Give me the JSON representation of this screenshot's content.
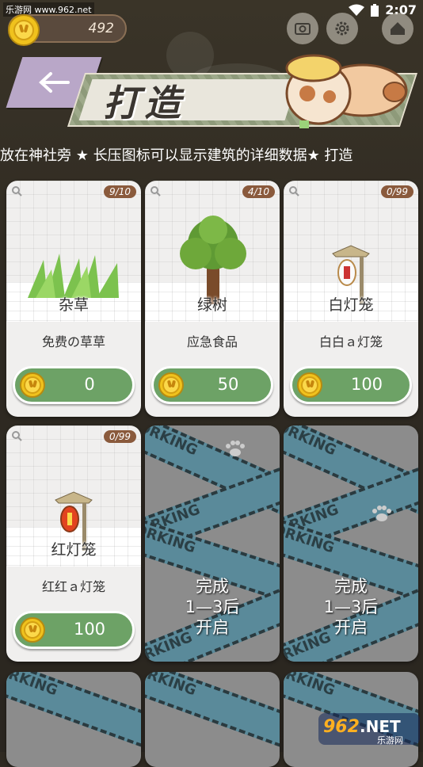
{
  "status_bar": {
    "site_tag": "乐游网 www.962.net",
    "time": "2:07"
  },
  "coins": {
    "amount": "492"
  },
  "header": {
    "title": "打造"
  },
  "marquee": {
    "text": "放在神社旁    ★ 长压图标可以显示建筑的详细数据★  打造"
  },
  "items": [
    {
      "name": "杂草",
      "count": "9/10",
      "desc": "免费の草草",
      "price": "0"
    },
    {
      "name": "绿树",
      "count": "4/10",
      "desc": "应急食品",
      "price": "50"
    },
    {
      "name": "白灯笼",
      "count": "0/99",
      "desc": "白白ａ灯笼",
      "price": "100"
    },
    {
      "name": "红灯笼",
      "count": "0/99",
      "desc": "红红ａ灯笼",
      "price": "100"
    }
  ],
  "locked": {
    "tape_text": "WORKING",
    "line1": "完成",
    "line2": "1—3后",
    "line3": "开启"
  },
  "watermark": {
    "brand": "962",
    "suffix": ".NET",
    "sub": "乐游网"
  },
  "colors": {
    "price_button": "#6da266",
    "count_badge": "#8a5a3c",
    "back_button": "#b9a7c8",
    "tape": "#5a8a9a"
  }
}
